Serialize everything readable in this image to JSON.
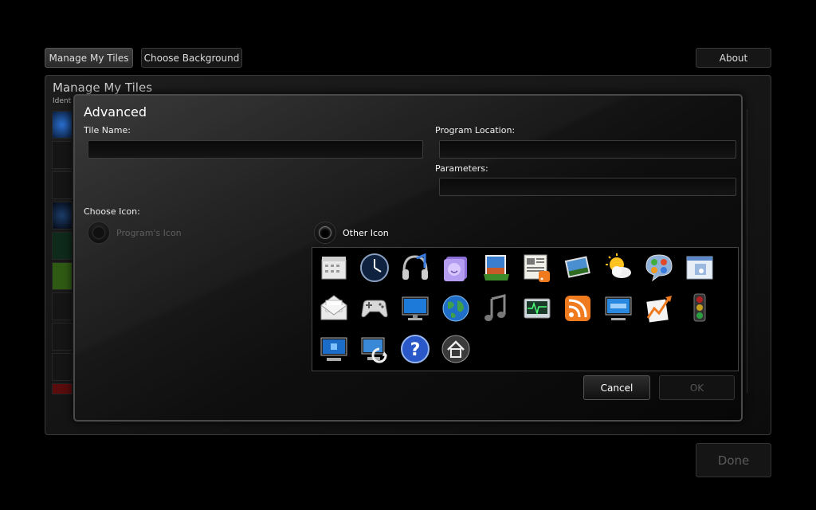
{
  "topbar": {
    "manage_label": "Manage My Tiles",
    "background_label": "Choose Background",
    "about_label": "About"
  },
  "background_panel": {
    "title": "Manage My Tiles",
    "subtitle": "Ident"
  },
  "done_label": "Done",
  "dialog": {
    "title": "Advanced",
    "tile_name_label": "Tile Name:",
    "tile_name_value": "",
    "program_location_label": "Program Location:",
    "program_location_value": "",
    "parameters_label": "Parameters:",
    "parameters_value": "",
    "choose_icon_label": "Choose Icon:",
    "radio_program_icon": "Program's Icon",
    "radio_other_icon": "Other Icon",
    "selected_radio": "other",
    "cancel_label": "Cancel",
    "ok_label": "OK"
  },
  "icons": [
    "calendar-icon",
    "clock-icon",
    "headphones-icon",
    "contacts-icon",
    "photo-gallery-icon",
    "news-rss-icon",
    "photo-slideshow-icon",
    "weather-icon",
    "messenger-icon",
    "window-icon",
    "mail-icon",
    "gamepad-icon",
    "monitor-icon",
    "globe-icon",
    "music-notes-icon",
    "media-center-icon",
    "rss-icon",
    "remote-desktop-icon",
    "stocks-icon",
    "traffic-light-icon",
    "computer-icon",
    "system-restore-icon",
    "help-icon",
    "home-icon"
  ],
  "colors": {
    "accent_blue": "#2a6fd0",
    "rss_orange": "#f07a1e"
  }
}
